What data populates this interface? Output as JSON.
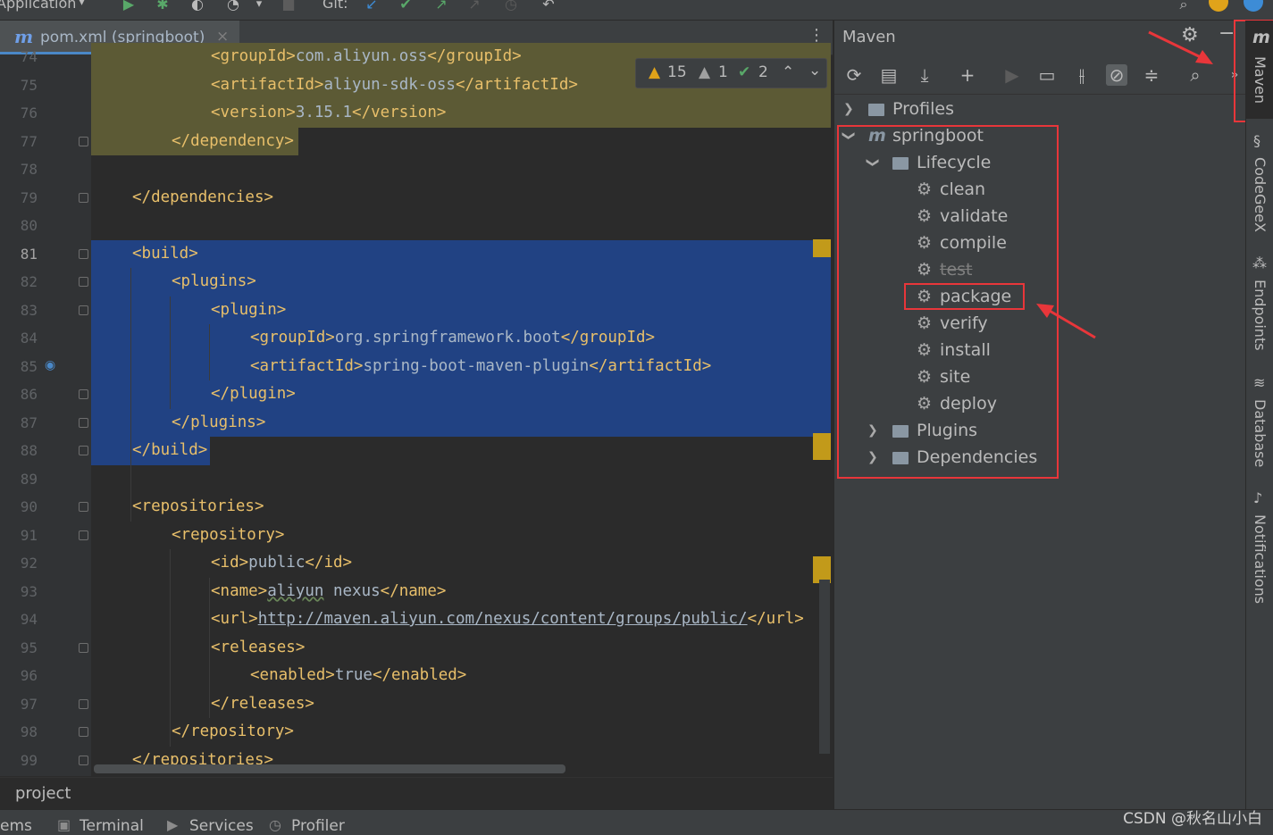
{
  "toolbar": {
    "run_config": "Application",
    "git_label": "Git:",
    "icons": [
      "run-icon",
      "debug-icon",
      "coverage-icon",
      "profile-icon",
      "more-icon",
      "stop-icon",
      "git-update-icon",
      "git-commit-icon",
      "git-push-icon",
      "git-history-icon",
      "rollback-icon",
      "search-icon",
      "update-icon",
      "jetbrains-icon"
    ]
  },
  "editor": {
    "tab_label": "pom.xml (springboot)",
    "tab_close": "×",
    "more_menu": "⋮",
    "inspections": {
      "warnings": "15",
      "weak_warnings": "1",
      "ok": "2"
    },
    "lines": [
      {
        "n": "74",
        "indent": 3,
        "parts": [
          [
            "tag",
            "<groupId>"
          ],
          [
            "txt",
            "com.aliyun.oss"
          ],
          [
            "tag",
            "</groupId>"
          ]
        ]
      },
      {
        "n": "75",
        "indent": 3,
        "parts": [
          [
            "tag",
            "<artifactId>"
          ],
          [
            "txt",
            "aliyun-sdk-oss"
          ],
          [
            "tag",
            "</artifactId>"
          ]
        ]
      },
      {
        "n": "76",
        "indent": 3,
        "parts": [
          [
            "tag",
            "<version>"
          ],
          [
            "txt",
            "3.15.1"
          ],
          [
            "tag",
            "</version>"
          ]
        ]
      },
      {
        "n": "77",
        "indent": 2,
        "parts": [
          [
            "tag",
            "</dependency>"
          ]
        ]
      },
      {
        "n": "78",
        "indent": 0,
        "parts": []
      },
      {
        "n": "79",
        "indent": 1,
        "parts": [
          [
            "tag",
            "</dependencies>"
          ]
        ]
      },
      {
        "n": "80",
        "indent": 0,
        "parts": []
      },
      {
        "n": "81",
        "indent": 1,
        "parts": [
          [
            "tag",
            "<build>"
          ]
        ]
      },
      {
        "n": "82",
        "indent": 2,
        "parts": [
          [
            "tag",
            "<plugins>"
          ]
        ]
      },
      {
        "n": "83",
        "indent": 3,
        "parts": [
          [
            "tag",
            "<plugin>"
          ]
        ]
      },
      {
        "n": "84",
        "indent": 4,
        "parts": [
          [
            "tag",
            "<groupId>"
          ],
          [
            "txt",
            "org.springframework.boot"
          ],
          [
            "tag",
            "</groupId>"
          ]
        ]
      },
      {
        "n": "85",
        "indent": 4,
        "parts": [
          [
            "tag",
            "<artifactId>"
          ],
          [
            "txt",
            "spring-boot-maven-plugin"
          ],
          [
            "tag",
            "</artifactId>"
          ]
        ]
      },
      {
        "n": "86",
        "indent": 3,
        "parts": [
          [
            "tag",
            "</plugin>"
          ]
        ]
      },
      {
        "n": "87",
        "indent": 2,
        "parts": [
          [
            "tag",
            "</plugins>"
          ]
        ]
      },
      {
        "n": "88",
        "indent": 1,
        "parts": [
          [
            "tag",
            "</build>"
          ]
        ]
      },
      {
        "n": "89",
        "indent": 0,
        "parts": []
      },
      {
        "n": "90",
        "indent": 1,
        "parts": [
          [
            "tag",
            "<repositories>"
          ]
        ]
      },
      {
        "n": "91",
        "indent": 2,
        "parts": [
          [
            "tag",
            "<repository>"
          ]
        ]
      },
      {
        "n": "92",
        "indent": 3,
        "parts": [
          [
            "tag",
            "<id>"
          ],
          [
            "txt",
            "public"
          ],
          [
            "tag",
            "</id>"
          ]
        ]
      },
      {
        "n": "93",
        "indent": 3,
        "parts": [
          [
            "tag",
            "<name>"
          ],
          [
            "uline",
            "aliyun"
          ],
          [
            "txt",
            " nexus"
          ],
          [
            "tag",
            "</name>"
          ]
        ]
      },
      {
        "n": "94",
        "indent": 3,
        "parts": [
          [
            "tag",
            "<url>"
          ],
          [
            "link",
            "http://maven.aliyun.com/nexus/content/groups/public/"
          ],
          [
            "tag",
            "</url>"
          ]
        ]
      },
      {
        "n": "95",
        "indent": 3,
        "parts": [
          [
            "tag",
            "<releases>"
          ]
        ]
      },
      {
        "n": "96",
        "indent": 4,
        "parts": [
          [
            "tag",
            "<enabled>"
          ],
          [
            "txt",
            "true"
          ],
          [
            "tag",
            "</enabled>"
          ]
        ]
      },
      {
        "n": "97",
        "indent": 3,
        "parts": [
          [
            "tag",
            "</releases>"
          ]
        ]
      },
      {
        "n": "98",
        "indent": 2,
        "parts": [
          [
            "tag",
            "</repository>"
          ]
        ]
      },
      {
        "n": "99",
        "indent": 1,
        "parts": [
          [
            "tag",
            "</repositories>"
          ]
        ]
      }
    ],
    "current_line": "81",
    "breadcrumb": "project"
  },
  "maven": {
    "title": "Maven",
    "tree": {
      "profiles": "Profiles",
      "project": "springboot",
      "lifecycle": "Lifecycle",
      "phases": [
        "clean",
        "validate",
        "compile",
        "test",
        "package",
        "verify",
        "install",
        "site",
        "deploy"
      ],
      "plugins": "Plugins",
      "dependencies": "Dependencies"
    }
  },
  "right_strip": [
    "Maven",
    "CodeGeeX",
    "Endpoints",
    "Database",
    "Notifications"
  ],
  "bottom_bar": [
    "ems",
    "Terminal",
    "Services",
    "Profiler"
  ],
  "watermark": "CSDN @秋名山小白",
  "colors": {
    "tag": "#e8bf6a",
    "text": "#a9b7c6",
    "selection": "#214283",
    "annotation": "#e8363a"
  }
}
